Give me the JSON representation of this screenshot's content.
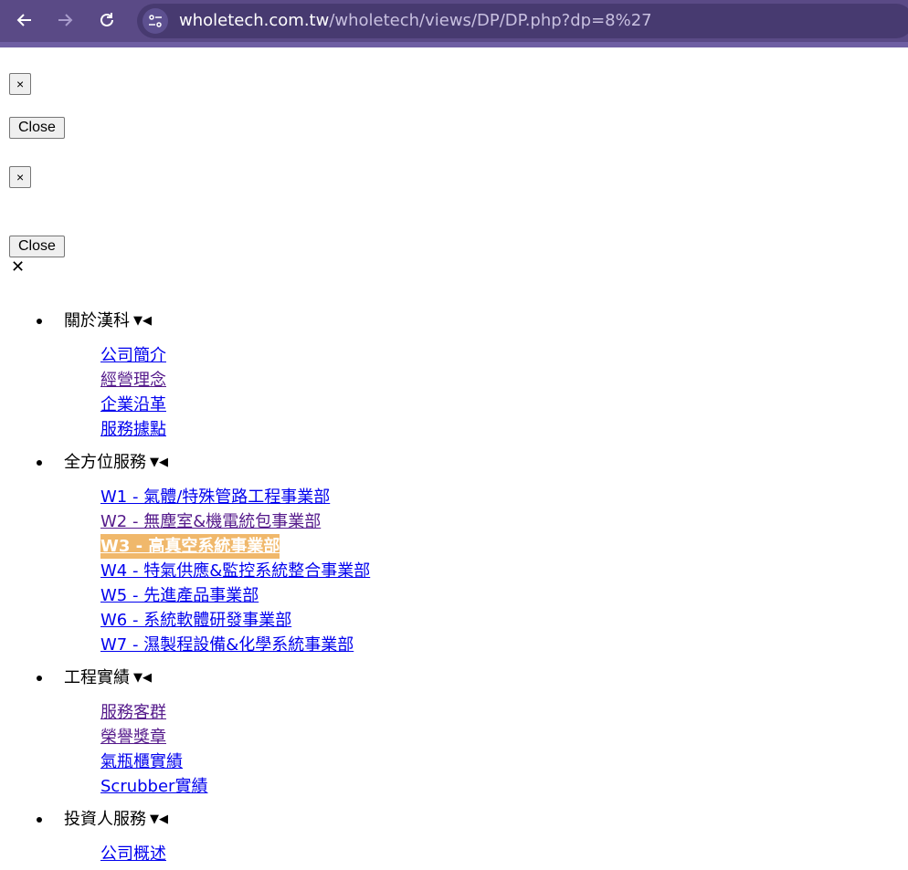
{
  "browser": {
    "back_icon": "arrow-left-icon",
    "forward_icon": "arrow-right-icon",
    "reload_icon": "reload-icon",
    "site_info_icon": "tune-icon",
    "url_host": "wholetech.com.tw",
    "url_path": "/wholetech/views/DP/DP.php?dp=8%27"
  },
  "buttons": {
    "x1": "×",
    "close1": "Close",
    "x2": "×",
    "close2": "Close",
    "close_glyph": "✕"
  },
  "menu": {
    "about": {
      "label": "關於漢科",
      "links": [
        "公司簡介",
        "經營理念",
        "企業沿革",
        "服務據點"
      ]
    },
    "services": {
      "label": "全方位服務",
      "links": [
        "W1 - 氣體/特殊管路工程事業部",
        "W2 - 無塵室&機電統包事業部",
        "W3 - 高真空系統事業部",
        "W4 - 特氣供應&監控系統整合事業部",
        "W5 - 先進產品事業部",
        "W6 - 系統軟體研發事業部",
        "W7 - 濕製程設備&化學系統事業部"
      ]
    },
    "projects": {
      "label": "工程實績",
      "links": [
        "服務客群",
        "榮譽獎章",
        "氣瓶櫃實績",
        "Scrubber實績"
      ]
    },
    "investors": {
      "label": "投資人服務",
      "links": [
        "公司概述"
      ]
    }
  },
  "colors": {
    "chrome": "#5a4a86",
    "link": "#0000ee",
    "visited": "#551a8b",
    "active_bg": "#f0b86b"
  }
}
